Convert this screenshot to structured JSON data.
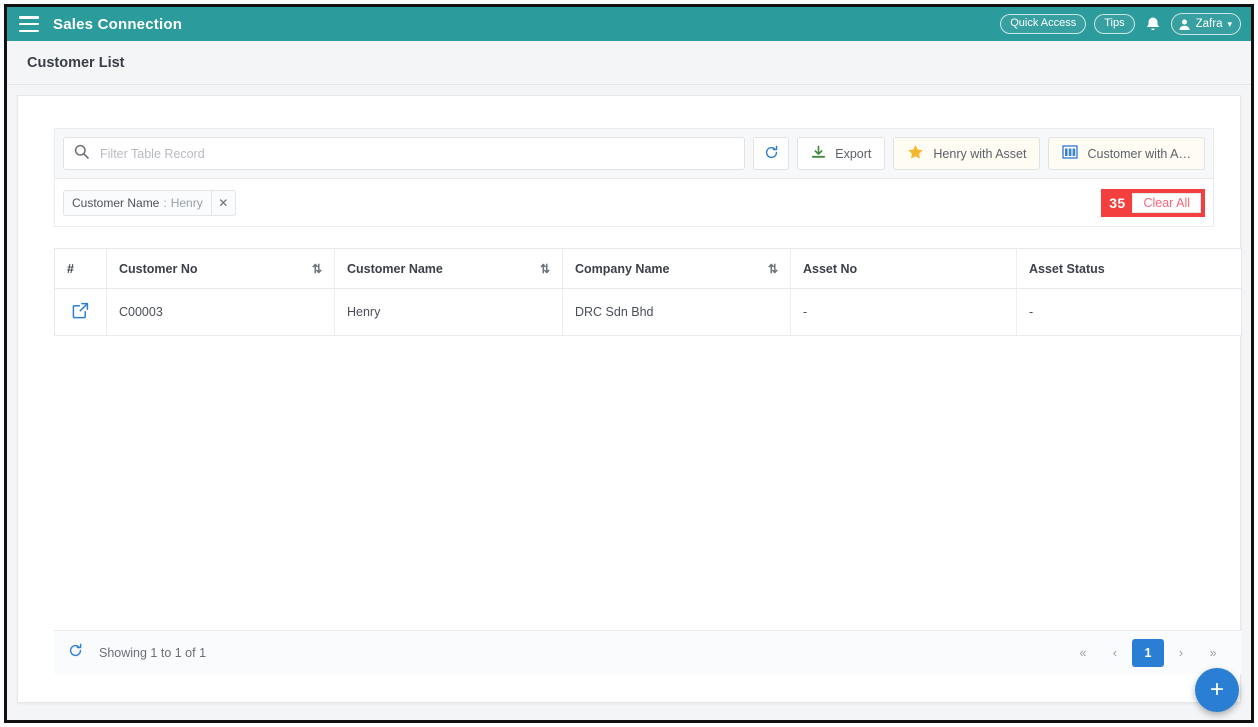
{
  "appbar": {
    "menu_icon": "hamburger-icon",
    "title": "Sales Connection",
    "quick_access_label": "Quick Access",
    "tips_label": "Tips",
    "bell_icon": "bell-icon",
    "user_name": "Zafra",
    "brand_color": "#2c9b9b"
  },
  "page": {
    "title": "Customer List"
  },
  "toolbar": {
    "search_placeholder": "Filter Table Record",
    "search_value": "",
    "search_icon": "search-icon",
    "refresh_icon": "refresh-icon",
    "export_label": "Export",
    "export_icon": "download-icon",
    "henry_asset_label": "Henry with Asset",
    "henry_asset_icon": "star-icon",
    "customer_asset_label": "Customer with A…",
    "customer_asset_icon": "columns-icon"
  },
  "filters": {
    "chip": {
      "field": "Customer Name",
      "separator": ":",
      "value": "Henry",
      "remove_icon": "close-icon"
    },
    "annotation_number": "35",
    "clear_all_label": "Clear All",
    "annotation_color": "#f43f3f"
  },
  "table": {
    "columns": [
      {
        "label": "#",
        "sortable": false
      },
      {
        "label": "Customer No",
        "sortable": true
      },
      {
        "label": "Customer Name",
        "sortable": true
      },
      {
        "label": "Company Name",
        "sortable": true
      },
      {
        "label": "Asset No",
        "sortable": false
      },
      {
        "label": "Asset Status",
        "sortable": false
      }
    ],
    "sort_icon": "sort-icon",
    "rows": [
      {
        "open_icon": "external-link-icon",
        "customer_no": "C00003",
        "customer_name": "Henry",
        "company_name": "DRC Sdn Bhd",
        "asset_no": "-",
        "asset_status": "-"
      }
    ]
  },
  "footer": {
    "refresh_icon": "refresh-icon",
    "showing_text": "Showing 1 to 1 of 1",
    "pager": {
      "first": "«",
      "prev": "‹",
      "pages": [
        "1"
      ],
      "active_page": "1",
      "next": "›",
      "last": "»"
    }
  },
  "fab": {
    "icon": "plus-icon",
    "label": "+",
    "color": "#2a7fd4"
  }
}
